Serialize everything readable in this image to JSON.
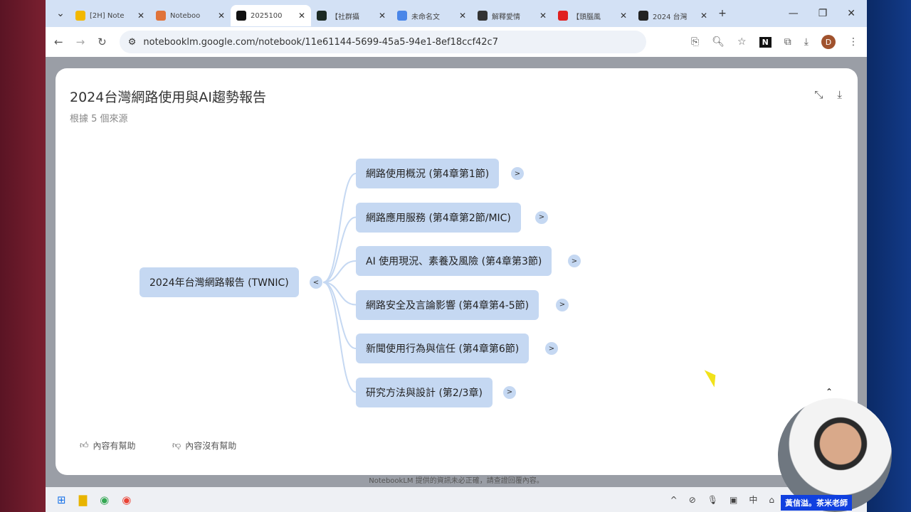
{
  "browser": {
    "tabs": [
      {
        "title": "[2H] Note",
        "color": "#f2b800"
      },
      {
        "title": "Noteboo",
        "color": "#e0733a"
      },
      {
        "title": "2025100",
        "color": "#111111"
      },
      {
        "title": "【社群攝",
        "color": "#1c2a24"
      },
      {
        "title": "未命名文",
        "color": "#4a86e8"
      },
      {
        "title": "解釋愛情",
        "color": "#333333"
      },
      {
        "title": "【頭腦風",
        "color": "#e02020"
      },
      {
        "title": "2024 台灣",
        "color": "#222222"
      }
    ],
    "url": "notebooklm.google.com/notebook/11e61144-5699-45a5-94e1-8ef18ccf42c7"
  },
  "mindmap": {
    "title": "2024台灣網路使用與AI趨勢報告",
    "subtitle": "根據 5 個來源",
    "root": "2024年台灣網路報告 (TWNIC)",
    "children": [
      "網路使用概況 (第4章第1節)",
      "網路應用服務 (第4章第2節/MIC)",
      "AI 使用現況、素養及風險 (第4章第3節)",
      "網路安全及言論影響 (第4章第4-5節)",
      "新聞使用行為與信任 (第4章第6節)",
      "研究方法與設計 (第2/3章)"
    ],
    "helpful": "內容有幫助",
    "not_helpful": "內容沒有幫助"
  },
  "footer": "NotebookLM 提供的資訊未必正確，請查證回覆內容。",
  "taskbar": {
    "ime": "中"
  },
  "overlay": {
    "name_tag": "黃信溢。茶米老師"
  }
}
